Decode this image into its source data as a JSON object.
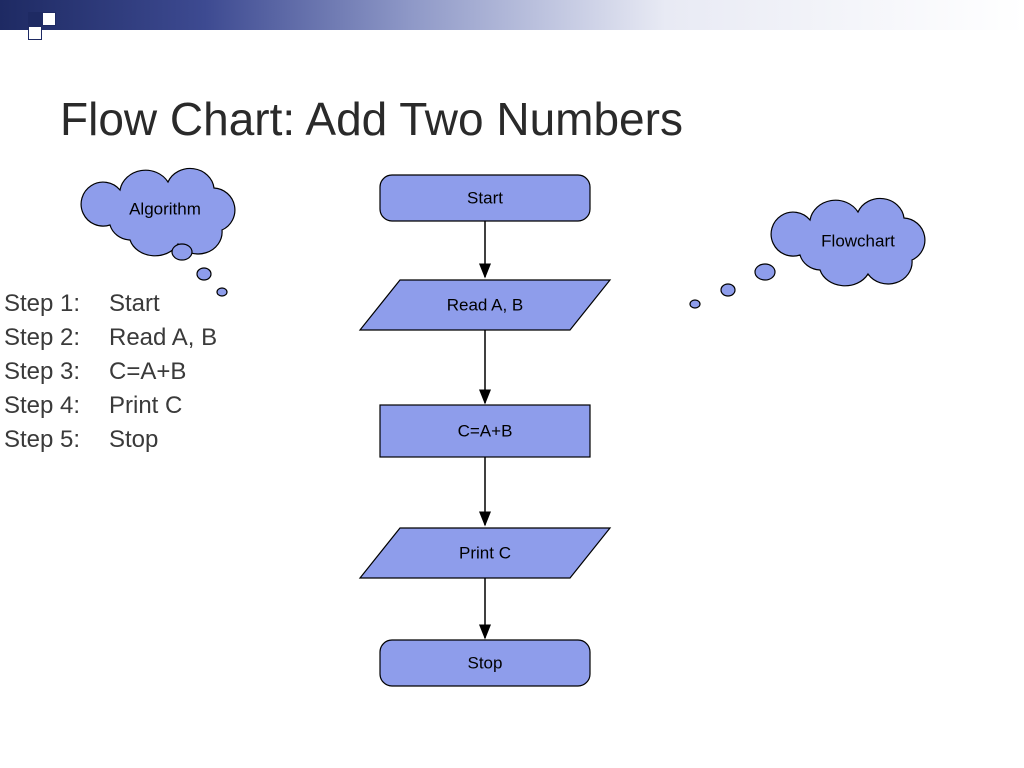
{
  "title": "Flow Chart: Add Two Numbers",
  "clouds": {
    "algorithm": "Algorithm",
    "flowchart": "Flowchart"
  },
  "steps": [
    {
      "label": "Step 1:",
      "text": "Start"
    },
    {
      "label": "Step 2:",
      "text": "Read A, B"
    },
    {
      "label": "Step 3:",
      "text": "C=A+B"
    },
    {
      "label": "Step 4:",
      "text": "Print C"
    },
    {
      "label": "Step 5:",
      "text": "Stop"
    }
  ],
  "flow": {
    "start": "Start",
    "read": "Read A, B",
    "process": "C=A+B",
    "print": "Print C",
    "stop": "Stop"
  },
  "chart_data": {
    "type": "flowchart",
    "title": "Flow Chart: Add Two Numbers",
    "nodes": [
      {
        "id": "start",
        "shape": "terminator",
        "label": "Start"
      },
      {
        "id": "read",
        "shape": "parallelogram",
        "label": "Read A, B"
      },
      {
        "id": "process",
        "shape": "rectangle",
        "label": "C=A+B"
      },
      {
        "id": "print",
        "shape": "parallelogram",
        "label": "Print C"
      },
      {
        "id": "stop",
        "shape": "terminator",
        "label": "Stop"
      }
    ],
    "edges": [
      {
        "from": "start",
        "to": "read"
      },
      {
        "from": "read",
        "to": "process"
      },
      {
        "from": "process",
        "to": "print"
      },
      {
        "from": "print",
        "to": "stop"
      }
    ],
    "algorithm_steps": [
      "Start",
      "Read A, B",
      "C=A+B",
      "Print C",
      "Stop"
    ]
  }
}
